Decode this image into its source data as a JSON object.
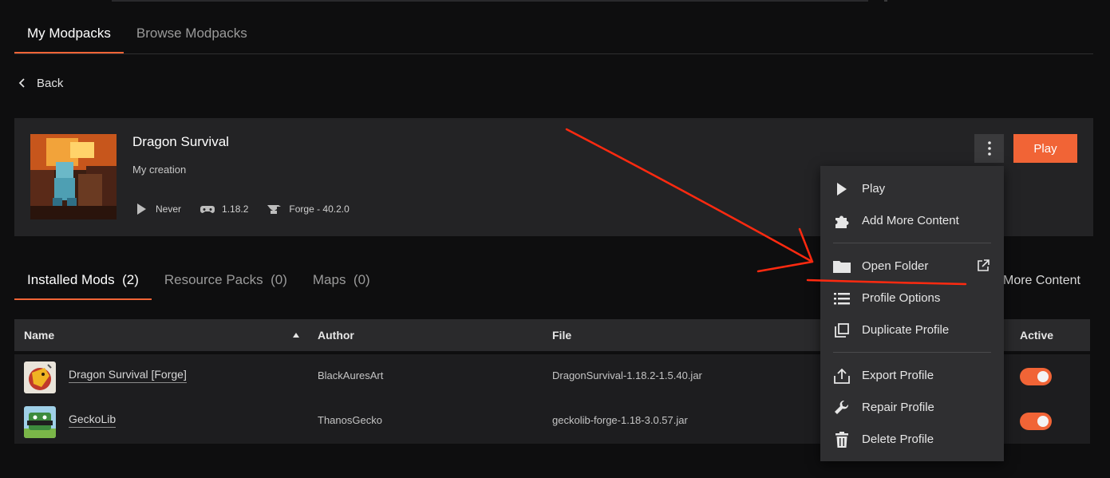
{
  "tabs": {
    "my_modpacks": "My Modpacks",
    "browse_modpacks": "Browse Modpacks"
  },
  "back_label": "Back",
  "profile": {
    "title": "Dragon Survival",
    "description": "My creation",
    "last_played": "Never",
    "game_version": "1.18.2",
    "loader": "Forge - 40.2.0",
    "play_label": "Play"
  },
  "sub_tabs": {
    "installed_mods": "Installed Mods",
    "installed_mods_count": "(2)",
    "resource_packs": "Resource Packs",
    "resource_packs_count": "(0)",
    "maps": "Maps",
    "maps_count": "(0)",
    "more_content": "More Content"
  },
  "table": {
    "headers": {
      "name": "Name",
      "author": "Author",
      "file": "File",
      "active": "Active"
    },
    "rows": [
      {
        "name": "Dragon Survival [Forge]",
        "author": "BlackAuresArt",
        "file": "DragonSurvival-1.18.2-1.5.40.jar",
        "active": true
      },
      {
        "name": "GeckoLib",
        "author": "ThanosGecko",
        "file": "geckolib-forge-1.18-3.0.57.jar",
        "active": true
      }
    ]
  },
  "menu": {
    "play": "Play",
    "add_more_content": "Add More Content",
    "open_folder": "Open Folder",
    "profile_options": "Profile Options",
    "duplicate_profile": "Duplicate Profile",
    "export_profile": "Export Profile",
    "repair_profile": "Repair Profile",
    "delete_profile": "Delete Profile"
  },
  "colors": {
    "accent": "#f16436",
    "annotation": "#ff2a10"
  }
}
